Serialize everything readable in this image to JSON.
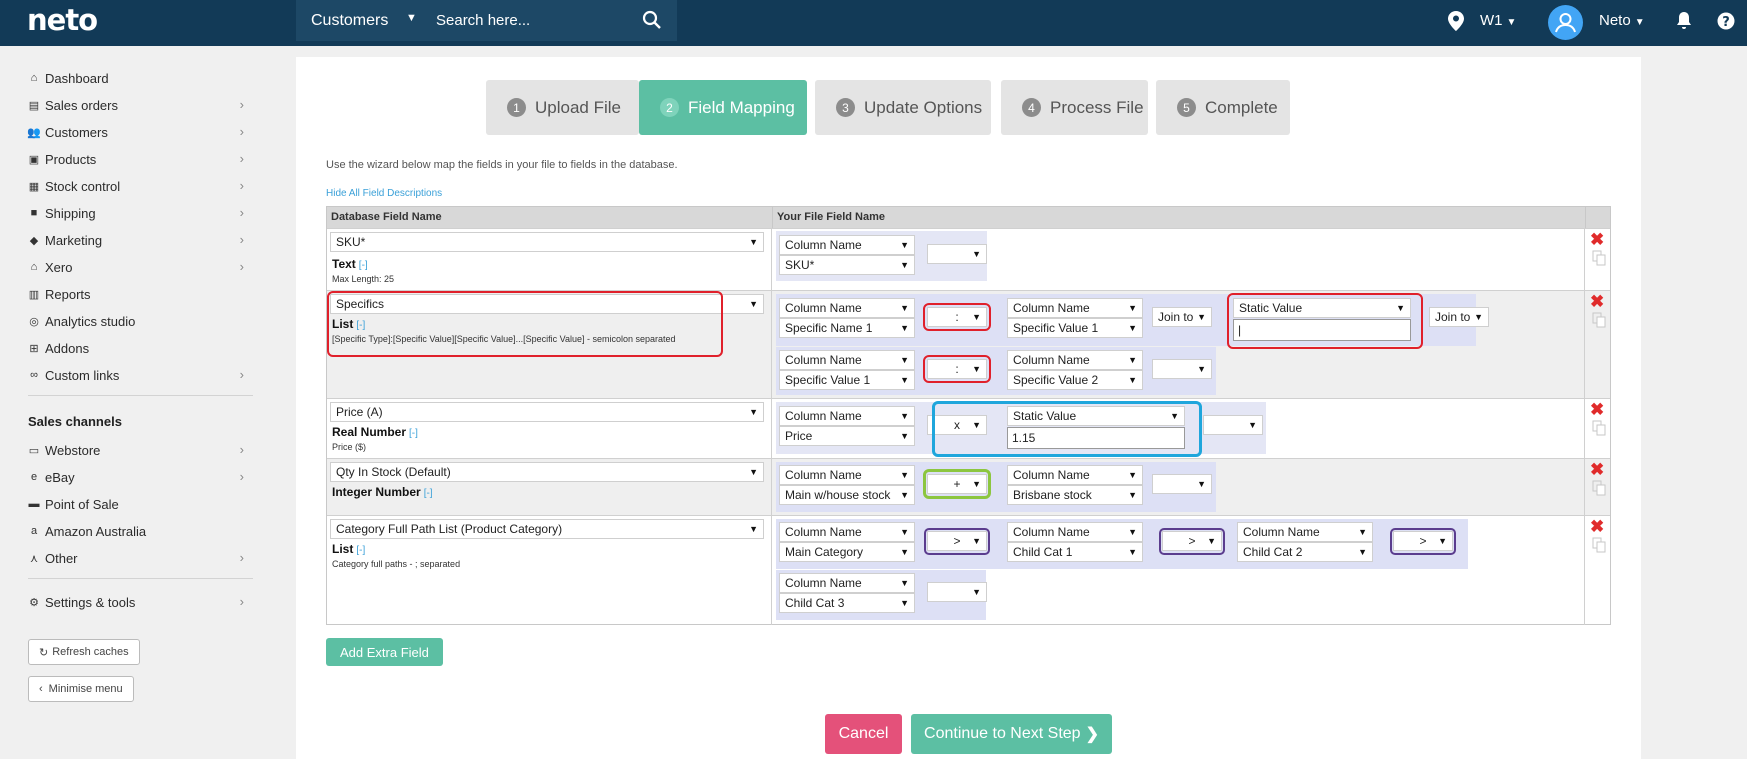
{
  "app": {
    "logo": "neto"
  },
  "search": {
    "scope": "Customers",
    "placeholder": "Search here..."
  },
  "header": {
    "location": "W1",
    "user": "Neto"
  },
  "sidebar": {
    "items": [
      {
        "label": "Dashboard",
        "icon": "home-icon"
      },
      {
        "label": "Sales orders",
        "icon": "document-icon"
      },
      {
        "label": "Customers",
        "icon": "users-icon"
      },
      {
        "label": "Products",
        "icon": "box-icon"
      },
      {
        "label": "Stock control",
        "icon": "clipboard-icon"
      },
      {
        "label": "Shipping",
        "icon": "truck-icon"
      },
      {
        "label": "Marketing",
        "icon": "tag-icon"
      },
      {
        "label": "Xero",
        "icon": "bank-icon"
      },
      {
        "label": "Reports",
        "icon": "chart-icon"
      },
      {
        "label": "Analytics studio",
        "icon": "analytics-icon"
      },
      {
        "label": "Addons",
        "icon": "plus-square-icon"
      },
      {
        "label": "Custom links",
        "icon": "link-icon"
      }
    ],
    "channels_title": "Sales channels",
    "channels": [
      {
        "label": "Webstore",
        "icon": "webstore-icon"
      },
      {
        "label": "eBay",
        "icon": "ebay-icon"
      },
      {
        "label": "Point of Sale",
        "icon": "pos-icon"
      },
      {
        "label": "Amazon Australia",
        "icon": "amazon-icon"
      },
      {
        "label": "Other",
        "icon": "other-icon"
      }
    ],
    "settings": "Settings & tools",
    "refresh": "Refresh caches",
    "minimise": "Minimise menu"
  },
  "wizard": {
    "steps": [
      {
        "num": "1",
        "label": "Upload File"
      },
      {
        "num": "2",
        "label": "Field Mapping"
      },
      {
        "num": "3",
        "label": "Update Options"
      },
      {
        "num": "4",
        "label": "Process File"
      },
      {
        "num": "5",
        "label": "Complete"
      }
    ],
    "active_step": 2,
    "intro": "Use the wizard below map the fields in your file to fields in the database.",
    "hide_descriptions": "Hide All Field Descriptions"
  },
  "table": {
    "col_db": "Database Field Name",
    "col_file": "Your File Field Name",
    "toggle": "[-]",
    "rows": {
      "sku": {
        "field": "SKU*",
        "type": "Text",
        "desc": "Max Length: 25",
        "col1": "Column Name",
        "col1v": "SKU*"
      },
      "specifics": {
        "field": "Specifics",
        "type": "List",
        "desc": "[Specific Type]:[Specific Value][Specific Value]...[Specific Value] - semicolon separated",
        "r1": {
          "c1": "Column Name",
          "c1v": "Specific Name 1",
          "op": ":",
          "c2": "Column Name",
          "c2v": "Specific Value 1",
          "join": "Join to",
          "static": "Static Value",
          "static_val": "|",
          "join2": "Join to"
        },
        "r2": {
          "c1": "Column Name",
          "c1v": "Specific Value 1",
          "op": ":",
          "c2": "Column Name",
          "c2v": "Specific Value 2"
        }
      },
      "price": {
        "field": "Price (A)",
        "type": "Real Number",
        "desc": "Price ($)",
        "c1": "Column Name",
        "c1v": "Price",
        "op": "x",
        "static": "Static Value",
        "static_val": "1.15"
      },
      "qty": {
        "field": "Qty In Stock (Default)",
        "type": "Integer Number",
        "c1": "Column Name",
        "c1v": "Main w/house stock",
        "op": "+",
        "c2": "Column Name",
        "c2v": "Brisbane stock"
      },
      "category": {
        "field": "Category Full Path List (Product Category)",
        "type": "List",
        "desc": "Category full paths - ; separated",
        "c1": "Column Name",
        "c1v": "Main Category",
        "op1": ">",
        "c2": "Column Name",
        "c2v": "Child Cat 1",
        "op2": ">",
        "c3": "Column Name",
        "c3v": "Child Cat 2",
        "op3": ">",
        "c4": "Column Name",
        "c4v": "Child Cat 3"
      }
    }
  },
  "buttons": {
    "add": "Add Extra Field",
    "cancel": "Cancel",
    "next": "Continue to Next Step"
  },
  "colors": {
    "topbar": "#123a57",
    "accent": "#5cbfa3",
    "cancel": "#e4517a",
    "highlight_red": "#e0202b",
    "highlight_blue": "#1fa6dc",
    "highlight_green": "#8cc63f",
    "highlight_purple": "#5b3d8e"
  }
}
